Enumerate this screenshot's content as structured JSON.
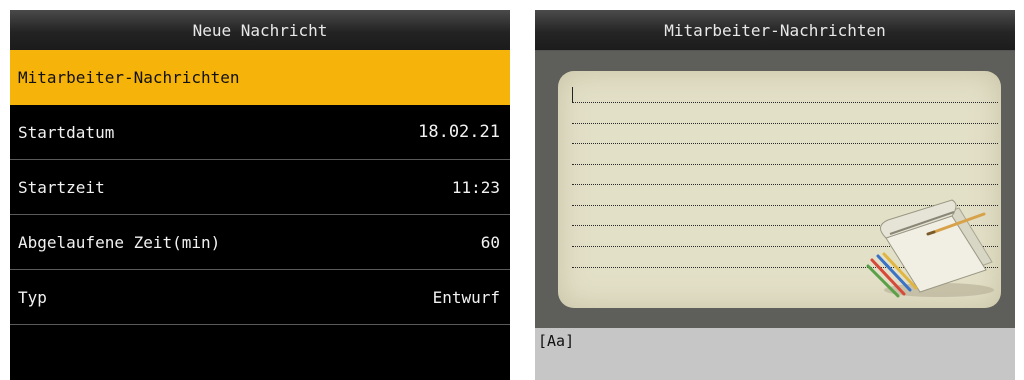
{
  "left_screen": {
    "title": "Neue Nachricht",
    "items": [
      {
        "label": "Mitarbeiter-Nachrichten",
        "value": ""
      },
      {
        "label": "Startdatum",
        "value": "18.02.21"
      },
      {
        "label": "Startzeit",
        "value": "11:23"
      },
      {
        "label": "Abgelaufene Zeit(min)",
        "value": "60"
      },
      {
        "label": "Typ",
        "value": "Entwurf"
      }
    ],
    "selected_index": 0
  },
  "right_screen": {
    "title": "Mitarbeiter-Nachrichten",
    "message_text": "",
    "input_mode": "[Aa]",
    "illustration": "notepad-pencils-icon"
  },
  "colors": {
    "highlight": "#f6b40a",
    "screen_bg": "#000000",
    "notepad_bg": "#e3e0c8",
    "frame_bg": "#5e5f5b",
    "input_bar_bg": "#c6c6c6"
  }
}
